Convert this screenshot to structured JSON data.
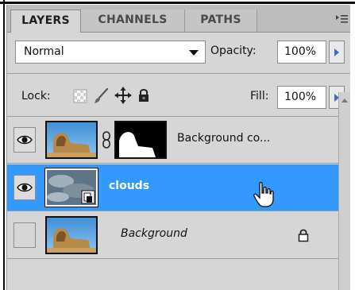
{
  "panel": {
    "tabs": [
      {
        "label": "LAYERS",
        "active": true
      },
      {
        "label": "CHANNELS",
        "active": false
      },
      {
        "label": "PATHS",
        "active": false
      }
    ],
    "menu_icon": "panel-menu-icon"
  },
  "blend": {
    "mode": "Normal",
    "opacity_label": "Opacity:",
    "opacity_value": "100%",
    "lock_label": "Lock:",
    "fill_label": "Fill:",
    "fill_value": "100%"
  },
  "layers": [
    {
      "name": "Background co...",
      "visible": true,
      "selected": false,
      "has_mask": true,
      "linked": true,
      "locked": false,
      "italic": false
    },
    {
      "name": "clouds",
      "visible": true,
      "selected": true,
      "smart_object": true,
      "locked": false,
      "italic": false
    },
    {
      "name": "Background",
      "visible": false,
      "selected": false,
      "locked": true,
      "italic": true
    }
  ],
  "colors": {
    "selection": "#3399ff",
    "panel_bg": "#d6d6d6",
    "tab_bg": "#bdbdbd",
    "accent": "#3a6fc0"
  }
}
